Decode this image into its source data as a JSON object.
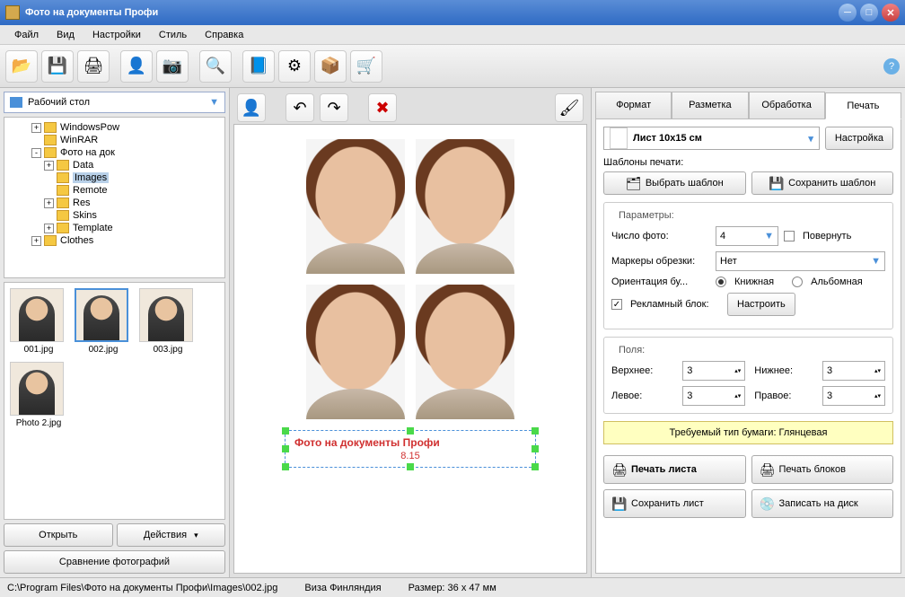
{
  "window": {
    "title": "Фото на документы Профи"
  },
  "menu": [
    "Файл",
    "Вид",
    "Настройки",
    "Стиль",
    "Справка"
  ],
  "left": {
    "path": "Рабочий стол",
    "tree": [
      {
        "indent": 2,
        "exp": "+",
        "label": "WindowsPow"
      },
      {
        "indent": 2,
        "exp": "",
        "label": "WinRAR"
      },
      {
        "indent": 2,
        "exp": "-",
        "label": "Фото на док"
      },
      {
        "indent": 3,
        "exp": "+",
        "label": "Data"
      },
      {
        "indent": 3,
        "exp": "",
        "label": "Images",
        "selected": true
      },
      {
        "indent": 3,
        "exp": "",
        "label": "Remote"
      },
      {
        "indent": 3,
        "exp": "+",
        "label": "Res"
      },
      {
        "indent": 3,
        "exp": "",
        "label": "Skins"
      },
      {
        "indent": 3,
        "exp": "+",
        "label": "Template"
      },
      {
        "indent": 2,
        "exp": "+",
        "label": "Clothes"
      }
    ],
    "thumbs": [
      {
        "name": "001.jpg"
      },
      {
        "name": "002.jpg",
        "selected": true
      },
      {
        "name": "003.jpg"
      },
      {
        "name": "Photo 2.jpg"
      }
    ],
    "open_btn": "Открыть",
    "actions_btn": "Действия",
    "compare_btn": "Сравнение фотографий"
  },
  "center": {
    "watermark_line1": "Фото на документы Профи",
    "watermark_line2": "8.15"
  },
  "right": {
    "tabs": [
      "Формат",
      "Разметка",
      "Обработка",
      "Печать"
    ],
    "active_tab": 3,
    "sheet_format": "Лист 10x15 см",
    "settings_btn": "Настройка",
    "templates_title": "Шаблоны печати:",
    "select_template_btn": "Выбрать шаблон",
    "save_template_btn": "Сохранить шаблон",
    "params_title": "Параметры:",
    "photo_count_label": "Число фото:",
    "photo_count": "4",
    "rotate_label": "Повернуть",
    "crop_markers_label": "Маркеры обрезки:",
    "crop_markers": "Нет",
    "orientation_label": "Ориентация бу...",
    "orient_portrait": "Книжная",
    "orient_landscape": "Альбомная",
    "ad_block_label": "Рекламный блок:",
    "configure_btn": "Настроить",
    "margins_title": "Поля:",
    "margin_top_label": "Верхнее:",
    "margin_bottom_label": "Нижнее:",
    "margin_left_label": "Левое:",
    "margin_right_label": "Правое:",
    "margin_top": "3",
    "margin_bottom": "3",
    "margin_left": "3",
    "margin_right": "3",
    "paper_req": "Требуемый тип бумаги: Глянцевая",
    "print_sheet_btn": "Печать листа",
    "print_blocks_btn": "Печать блоков",
    "save_sheet_btn": "Сохранить лист",
    "write_disk_btn": "Записать на диск"
  },
  "status": {
    "path": "C:\\Program Files\\Фото на документы Профи\\Images\\002.jpg",
    "profile": "Виза Финляндия",
    "size": "Размер: 36 x 47 мм"
  }
}
